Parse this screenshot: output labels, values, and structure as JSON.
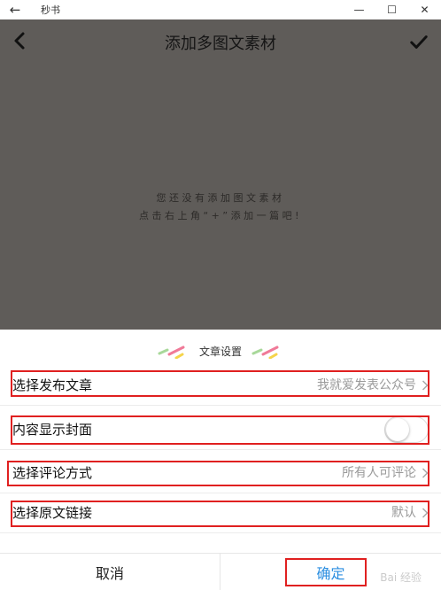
{
  "window": {
    "title": "秒书",
    "back_glyph": "←",
    "minimize_glyph": "—",
    "maximize_glyph": "☐",
    "close_glyph": "✕"
  },
  "header": {
    "title": "添加多图文素材",
    "back_icon": "chevron-left-icon",
    "confirm_icon": "check-icon"
  },
  "empty_state": {
    "line1": "您还没有添加图文素材",
    "line2": "点击右上角“+”添加一篇吧!"
  },
  "sheet": {
    "title": "文章设置",
    "rows": [
      {
        "label": "选择发布文章",
        "value": "我就爱发表公众号"
      },
      {
        "label": "内容显示封面",
        "toggle_on": false
      },
      {
        "label": "选择评论方式",
        "value": "所有人可评论"
      },
      {
        "label": "选择原文链接",
        "value": "默认"
      }
    ],
    "cancel_label": "取消",
    "confirm_label": "确定"
  },
  "colors": {
    "overlay": "#5f5c59",
    "confirm_text": "#2b8ee0",
    "highlight": "#e02020",
    "deco_green": "#a8d89a",
    "deco_pink": "#f07a98",
    "deco_yellow": "#f5d44a"
  },
  "watermark": "Bai 经验"
}
